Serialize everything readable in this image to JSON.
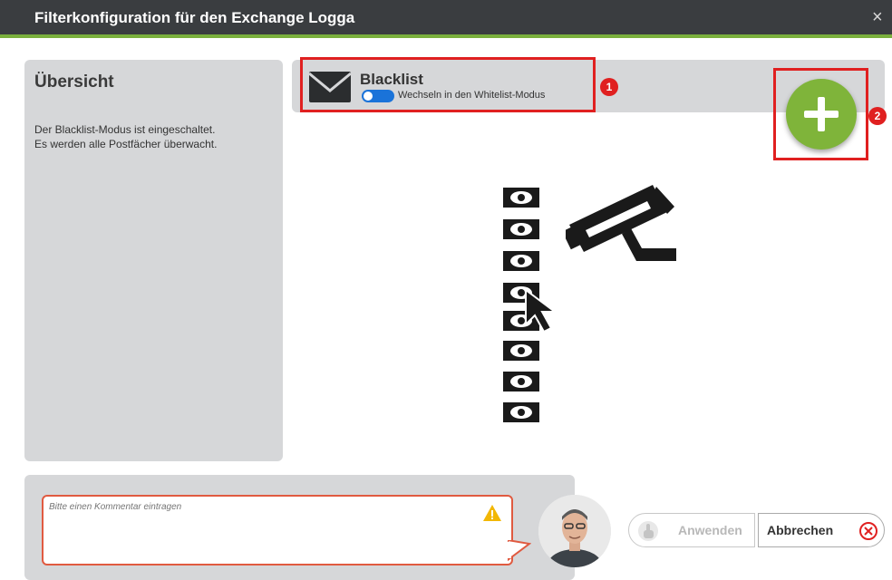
{
  "window": {
    "title": "Filterkonfiguration für den Exchange Logga",
    "close_glyph": "×"
  },
  "overview": {
    "heading": "Übersicht",
    "lines": [
      "Der Blacklist-Modus ist eingeschaltet.",
      "Es werden alle Postfächer überwacht."
    ]
  },
  "mode": {
    "title": "Blacklist",
    "toggle_label": "Wechseln in den Whitelist-Modus",
    "toggle_on": true,
    "icon": "envelope-icon"
  },
  "annotations": {
    "badge_1": "1",
    "badge_2": "2",
    "highlight_color": "#e02020"
  },
  "add_button": {
    "icon": "plus-icon",
    "color": "#7fb43a"
  },
  "illustration": {
    "eye_icon": "eye-envelope-icon",
    "eye_count": 8,
    "camera_icon": "security-camera-icon",
    "cursor_icon": "mouse-pointer-icon"
  },
  "comment": {
    "placeholder": "Bitte einen Kommentar eintragen",
    "warning_icon": "warning-icon"
  },
  "buttons": {
    "apply_label": "Anwenden",
    "cancel_label": "Abbrechen"
  },
  "colors": {
    "titlebar": "#3a3d40",
    "accent_green": "#7ab03d",
    "toggle_blue": "#1a73d9",
    "panel_gray": "#d6d7d9"
  }
}
